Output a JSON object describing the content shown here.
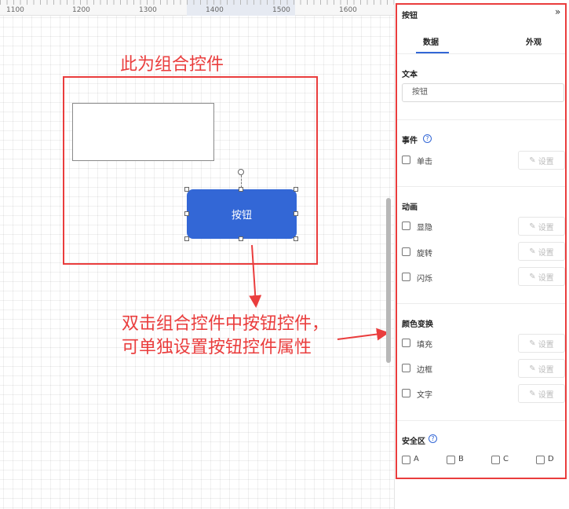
{
  "ruler": {
    "ticks": [
      "1100",
      "1200",
      "1300",
      "1400",
      "1500",
      "1600"
    ]
  },
  "canvas": {
    "group_annotation": "此为组合控件",
    "button_label": "按钮",
    "hint_line1": "双击组合控件中按钮控件，",
    "hint_line2": "可单独设置按钮控件属性"
  },
  "panel": {
    "title": "按钮",
    "collapse_icon": "double-chevron-right",
    "tabs": [
      {
        "label": "数据",
        "active": true
      },
      {
        "label": "外观",
        "active": false
      }
    ],
    "text_section": {
      "label": "文本",
      "value": "按钮"
    },
    "event_section": {
      "label": "事件",
      "items": [
        {
          "label": "单击",
          "setting": "设置"
        }
      ]
    },
    "animation_section": {
      "label": "动画",
      "items": [
        {
          "label": "显隐",
          "setting": "设置"
        },
        {
          "label": "旋转",
          "setting": "设置"
        },
        {
          "label": "闪烁",
          "setting": "设置"
        }
      ]
    },
    "color_section": {
      "label": "颜色变换",
      "items": [
        {
          "label": "填充",
          "setting": "设置"
        },
        {
          "label": "边框",
          "setting": "设置"
        },
        {
          "label": "文字",
          "setting": "设置"
        }
      ]
    },
    "safe_zone_section": {
      "label": "安全区",
      "options": [
        "A",
        "B",
        "C",
        "D"
      ]
    }
  },
  "colors": {
    "accent": "#3367d6",
    "annotation": "#ea3d3d",
    "button_fill": "#3367d6"
  }
}
